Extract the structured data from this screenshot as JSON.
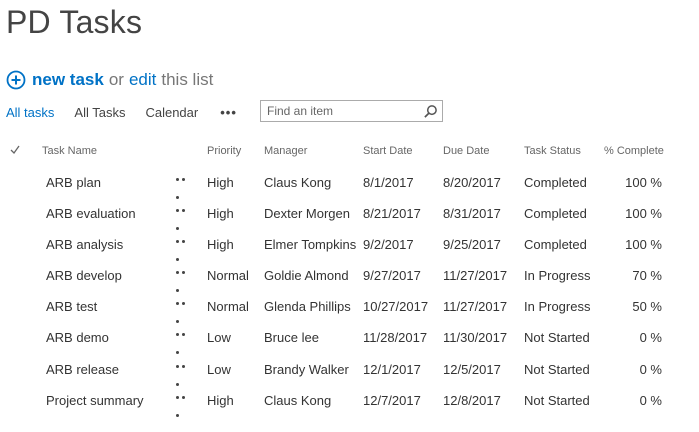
{
  "page": {
    "title": "PD Tasks"
  },
  "commands": {
    "new_task": "new task",
    "or_text": "or",
    "edit": "edit",
    "this_list": "this list"
  },
  "views": {
    "items": [
      "All tasks",
      "All Tasks",
      "Calendar"
    ],
    "more": "•••"
  },
  "search": {
    "placeholder": "Find an item"
  },
  "table": {
    "columns": [
      "Task Name",
      "Priority",
      "Manager",
      "Start Date",
      "Due Date",
      "Task Status",
      "% Complete"
    ],
    "rows": [
      {
        "task": "ARB plan",
        "priority": "High",
        "manager": "Claus Kong",
        "start": "8/1/2017",
        "due": "8/20/2017",
        "status": "Completed",
        "complete": "100 %"
      },
      {
        "task": "ARB evaluation",
        "priority": "High",
        "manager": "Dexter Morgen",
        "start": "8/21/2017",
        "due": "8/31/2017",
        "status": "Completed",
        "complete": "100 %"
      },
      {
        "task": "ARB analysis",
        "priority": "High",
        "manager": "Elmer Tompkins",
        "start": "9/2/2017",
        "due": "9/25/2017",
        "status": "Completed",
        "complete": "100 %"
      },
      {
        "task": "ARB develop",
        "priority": "Normal",
        "manager": "Goldie Almond",
        "start": "9/27/2017",
        "due": "11/27/2017",
        "status": "In Progress",
        "complete": "70 %"
      },
      {
        "task": "ARB test",
        "priority": "Normal",
        "manager": "Glenda Phillips",
        "start": "10/27/2017",
        "due": "11/27/2017",
        "status": "In Progress",
        "complete": "50 %"
      },
      {
        "task": "ARB demo",
        "priority": "Low",
        "manager": "Bruce lee",
        "start": "11/28/2017",
        "due": "11/30/2017",
        "status": "Not Started",
        "complete": "0 %"
      },
      {
        "task": "ARB release",
        "priority": "Low",
        "manager": "Brandy Walker",
        "start": "12/1/2017",
        "due": "12/5/2017",
        "status": "Not Started",
        "complete": "0 %"
      },
      {
        "task": "Project summary",
        "priority": "High",
        "manager": "Claus Kong",
        "start": "12/7/2017",
        "due": "12/8/2017",
        "status": "Not Started",
        "complete": "0 %"
      }
    ]
  },
  "colors": {
    "accent": "#0072c6",
    "text": "#333333",
    "muted": "#666666"
  }
}
